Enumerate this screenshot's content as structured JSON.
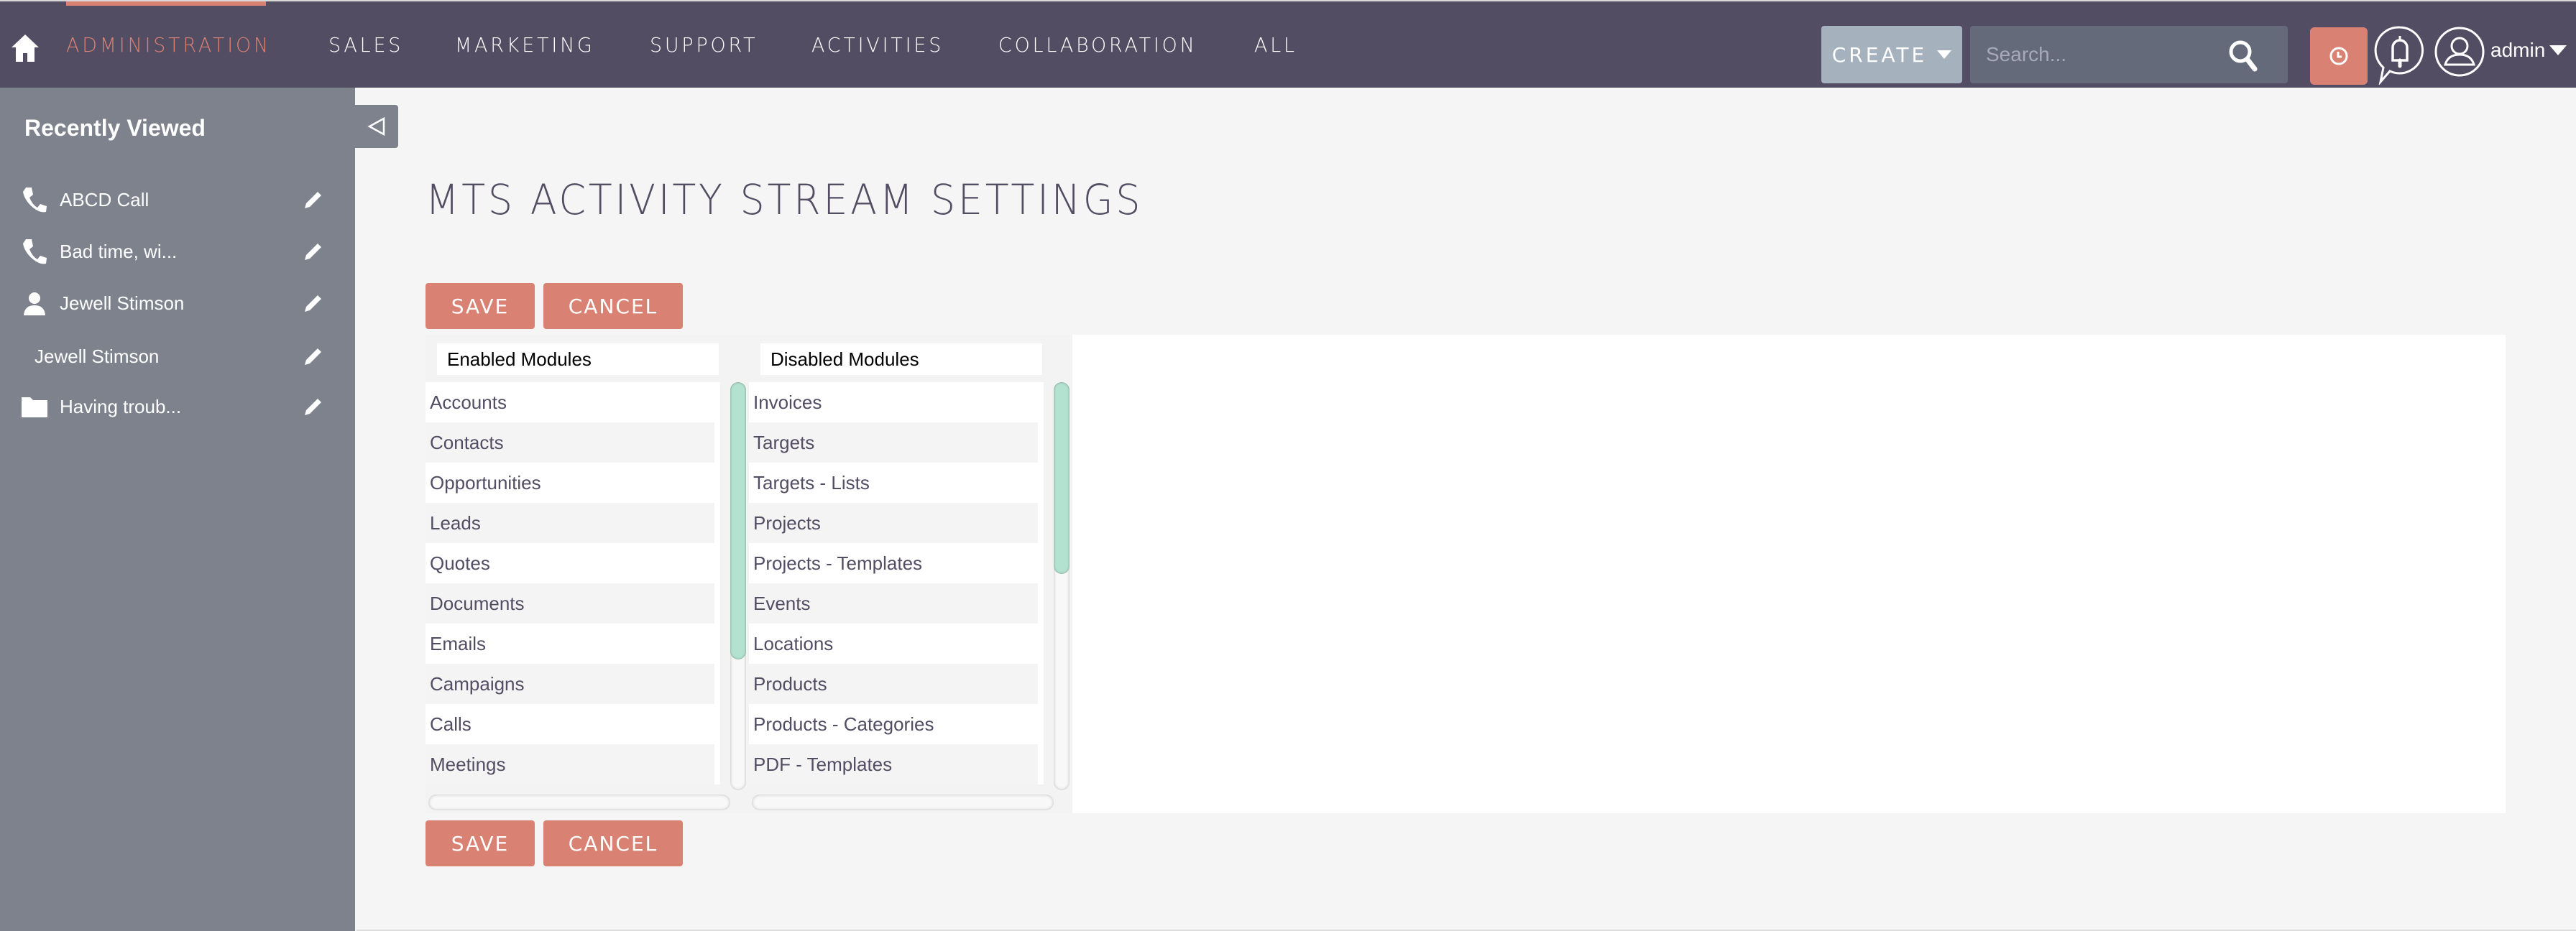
{
  "navbar": {
    "home_icon": "home-icon",
    "items": [
      {
        "label": "ADMINISTRATION",
        "active": true
      },
      {
        "label": "SALES",
        "active": false
      },
      {
        "label": "MARKETING",
        "active": false
      },
      {
        "label": "SUPPORT",
        "active": false
      },
      {
        "label": "ACTIVITIES",
        "active": false
      },
      {
        "label": "COLLABORATION",
        "active": false
      },
      {
        "label": "ALL",
        "active": false
      }
    ],
    "create_label": "CREATE",
    "search_placeholder": "Search...",
    "search_value": "",
    "user_name": "admin",
    "accent_color": "#d98274",
    "bar_color": "#534d64"
  },
  "sidebar": {
    "title": "Recently Viewed",
    "collapse_icon": "triangle-left-icon",
    "items": [
      {
        "label": "ABCD Call",
        "icon": "phone-icon"
      },
      {
        "label": "Bad time, wi...",
        "icon": "phone-icon"
      },
      {
        "label": "Jewell Stimson",
        "icon": "person-icon"
      },
      {
        "label": "Jewell Stimson",
        "icon": ""
      },
      {
        "label": "Having troub...",
        "icon": "folder-icon"
      }
    ]
  },
  "main": {
    "title": "MTS ACTIVITY STREAM SETTINGS",
    "save_label": "SAVE",
    "cancel_label": "CANCEL",
    "enabled": {
      "header": "Enabled Modules",
      "items": [
        "Accounts",
        "Contacts",
        "Opportunities",
        "Leads",
        "Quotes",
        "Documents",
        "Emails",
        "Campaigns",
        "Calls",
        "Meetings"
      ],
      "scroll_visible_fraction": 0.68,
      "scroll_position": 0
    },
    "disabled": {
      "header": "Disabled Modules",
      "items": [
        "Invoices",
        "Targets",
        "Targets - Lists",
        "Projects",
        "Projects - Templates",
        "Events",
        "Locations",
        "Products",
        "Products - Categories",
        "PDF - Templates"
      ],
      "scroll_visible_fraction": 0.47,
      "scroll_position": 0
    }
  }
}
